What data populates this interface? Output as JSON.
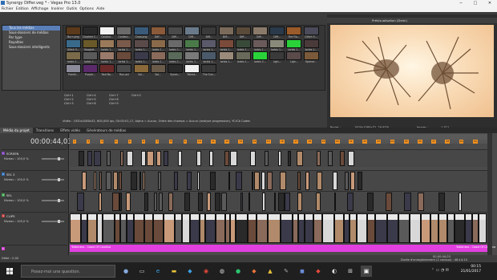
{
  "window": {
    "title": "Synergy Differ.veg * - Vegas Pro 13.0",
    "minimize": "─",
    "maximize": "□",
    "close": "✕"
  },
  "menu": [
    "Fichier",
    "Edition",
    "Affichage",
    "Insérer",
    "Outils",
    "Options",
    "Aide"
  ],
  "explorer": {
    "tree": [
      "Tous les médias",
      "Sous-dossiers de médias",
      "Par type",
      "Royalties",
      "Sous-dossiers intelligents"
    ],
    "media": [
      {
        "label": "Burn.png",
        "color": "#5a3a1a"
      },
      {
        "label": "Cloaked C...",
        "color": "#2a2a2a"
      },
      {
        "label": "Couleur...",
        "color": "#f2f2f2"
      },
      {
        "label": "Couleur...",
        "color": "#6a6a6a"
      },
      {
        "label": "Crow.png",
        "color": "#3a5a7a"
      },
      {
        "label": "Diff...",
        "color": "#8a5a3a"
      },
      {
        "label": "Diff...",
        "color": "#4a4a4a"
      },
      {
        "label": "Diff...",
        "color": "#6a7a8a"
      },
      {
        "label": "Diff...",
        "color": "#3a3a3a"
      },
      {
        "label": "Diff...",
        "color": "#7a6a5a"
      },
      {
        "label": "Diff...",
        "color": "#5a4a3a"
      },
      {
        "label": "Diff...",
        "color": "#8a7a6a"
      },
      {
        "label": "Diff...",
        "color": "#2a3a4a"
      },
      {
        "label": "Fire Fla...",
        "color": "#9a5a2a"
      },
      {
        "label": "Glitch 5...",
        "color": "#4a4a5a"
      },
      {
        "label": "Glitch 5...",
        "color": "#3a6a8a"
      },
      {
        "label": "Googlet...",
        "color": "#6a5a2a"
      },
      {
        "label": "Iorbis 1...",
        "color": "#9a7a5a"
      },
      {
        "label": "Iorbis 1...",
        "color": "#7a5a4a"
      },
      {
        "label": "Iorbis 1...",
        "color": "#5a4a4a"
      },
      {
        "label": "Iorbis 1...",
        "color": "#8a6a4a"
      },
      {
        "label": "Iorbis 1...",
        "color": "#6a6a6a"
      },
      {
        "label": "Iorbis 1...",
        "color": "#4a7a4a"
      },
      {
        "label": "Iorbis 1...",
        "color": "#5a5a6a"
      },
      {
        "label": "Iorbis 1...",
        "color": "#7a4a3a"
      },
      {
        "label": "Iorbis 1...",
        "color": "#3a4a3a"
      },
      {
        "label": "Iorbis 1...",
        "color": "#6a5a5a"
      },
      {
        "label": "Iorbis 1...",
        "color": "#8a8a7a"
      },
      {
        "label": "Iorbis 1...",
        "color": "#2ad23a"
      },
      {
        "label": "Iorbis 1...",
        "color": "#4a3a3a"
      },
      {
        "label": "Iorbis 1...",
        "color": "#7a6a4a"
      },
      {
        "label": "Iorbis 1...",
        "color": "#5a5a5a"
      },
      {
        "label": "Iorbis 1...",
        "color": "#9a7a6a"
      },
      {
        "label": "Iorbis 1...",
        "color": "#6a4a3a"
      },
      {
        "label": "Iorbis 1...",
        "color": "#3a3a4a"
      },
      {
        "label": "Iorbis 1...",
        "color": "#8a6a5a"
      },
      {
        "label": "Iorbis 1...",
        "color": "#5a6a5a"
      },
      {
        "label": "Iorbis 1...",
        "color": "#7a7a7a"
      },
      {
        "label": "Iorbis 1...",
        "color": "#4a5a6a"
      },
      {
        "label": "Iorbis 1...",
        "color": "#9a8a7a"
      },
      {
        "label": "Iorbis 1...",
        "color": "#6a6a5a"
      },
      {
        "label": "Iorbis 2...",
        "color": "#2ad23a"
      },
      {
        "label": "Ligh...",
        "color": "#3a3a3a"
      },
      {
        "label": "Ligh...",
        "color": "#5a4a4a"
      },
      {
        "label": "Openar...",
        "color": "#7a5a3a"
      },
      {
        "label": "Pointil...",
        "color": "#8a8a9a"
      },
      {
        "label": "Purple...",
        "color": "#5a2a6a"
      },
      {
        "label": "Red Bo...",
        "color": "#6a2a2a"
      },
      {
        "label": "Run.avi",
        "color": "#4a4a4a"
      },
      {
        "label": "Sol...",
        "color": "#8a6a3a"
      },
      {
        "label": "Sol...",
        "color": "#6a5a4a"
      },
      {
        "label": "Synes...",
        "color": "#2a2a2a"
      },
      {
        "label": "Tallest...",
        "color": "#f0f0f0"
      },
      {
        "label": "The Sun...",
        "color": "#3a3a3a"
      }
    ],
    "shortcuts": [
      "Ctrl+1",
      "Ctrl+4",
      "Ctrl+7",
      "Ctrl+0",
      "Ctrl+2",
      "Ctrl+5",
      "Ctrl+8",
      "",
      "Ctrl+3",
      "Ctrl+6",
      "Ctrl+9",
      ""
    ],
    "info": "Vidéo : 1920x1080x32, 600,000 ips, 00:00:01,17, Alpha = Aucun, Ordre des champs = Aucun (analyse progressive), YCrCb Codec"
  },
  "preview": {
    "title": "Prévisualisation (Demi)",
    "project_label": "Projet :",
    "project_value": "1920x1080x32, 29,970i",
    "prev_label": "Prévisualisation :",
    "prev_value": "960x540x32, 29,970p",
    "display_label": "Affichage :",
    "display_value": "346x195x32",
    "frame_label": "Image :",
    "frame_value": "1 311",
    "affichage_label": "Affichage :",
    "affichage_value": "1276x718x32"
  },
  "tabs": [
    "Média du projet",
    "Transitions",
    "Effets vidéo",
    "Générateurs de médias"
  ],
  "timeline": {
    "timecode": "00:00:44,03",
    "tracks": [
      {
        "num": "1",
        "name": "SCREEN",
        "vol": "Niveau : 100,0 %",
        "color": "#7a3fb5"
      },
      {
        "num": "2",
        "name": "SEL 2",
        "vol": "Niveau : 100,0 %",
        "color": "#2f6fb5"
      },
      {
        "num": "3",
        "name": "SEL",
        "vol": "Niveau : 100,0 %",
        "color": "#3f9f4f"
      },
      {
        "num": "4",
        "name": "CLIPS",
        "vol": "Niveau : 100,0 %",
        "color": "#b53f3f"
      },
      {
        "num": "5",
        "name": "",
        "vol": "",
        "color": "#d23fd2"
      }
    ],
    "markers": [
      "1",
      "2",
      "3",
      "4",
      "5",
      "6",
      "7",
      "8",
      "9",
      "10",
      "11",
      "12",
      "13",
      "14",
      "15",
      "16",
      "17",
      "18",
      "19",
      "20",
      "21",
      "22",
      "23",
      "24",
      "25",
      "26",
      "27",
      "28",
      "29",
      "30"
    ],
    "audio_label_1": "Tokkiness - Coast Of Carolina",
    "audio_label_2": "Tokkiness - Coast Of Carolina",
    "rate": "Débit : 0,00",
    "end_time": "00:00:44,03",
    "record_time": "Durée d'enregistrement (2 canaux) : 48:14:15"
  },
  "taskbar": {
    "search_placeholder": "Posez-moi une question.",
    "time": "00:15",
    "date": "21/01/2017"
  }
}
